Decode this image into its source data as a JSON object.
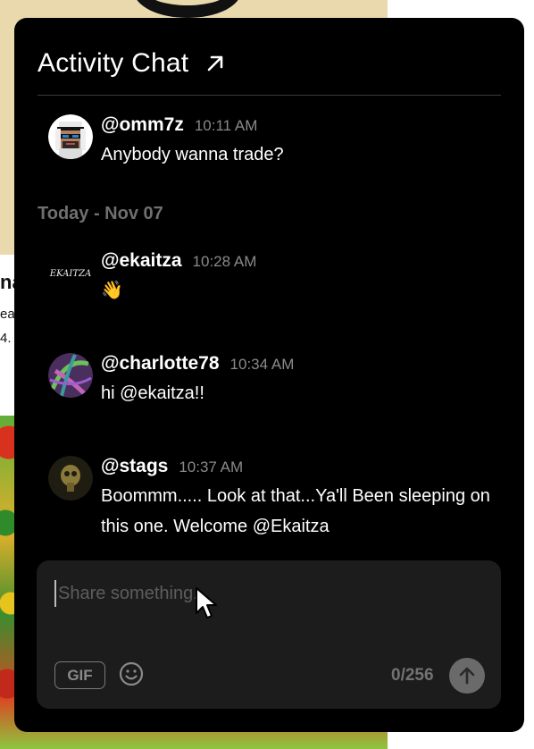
{
  "background": {
    "line1": "na",
    "line2": "ea",
    "line3": "4."
  },
  "chat": {
    "title": "Activity Chat",
    "expand_icon": "arrow-up-right-icon",
    "date_separator": "Today - Nov 07",
    "messages": [
      {
        "username": "@omm7z",
        "time": "10:11 AM",
        "text": "Anybody wanna trade?",
        "avatar": "pixel-art-avatar"
      },
      {
        "username": "@ekaitza",
        "time": "10:28 AM",
        "text": "👋",
        "avatar": "ekaitza-logo-avatar",
        "avatar_text": "EKAITZA"
      },
      {
        "username": "@charlotte78",
        "time": "10:34 AM",
        "text": "hi @ekaitza!!",
        "avatar": "abstract-art-avatar"
      },
      {
        "username": "@stags",
        "time": "10:37 AM",
        "text": "Boommm..... Look at that...Ya'll Been sleeping on this one. Welcome @Ekaitza",
        "avatar": "mask-avatar"
      }
    ]
  },
  "composer": {
    "placeholder": "Share something...",
    "gif_label": "GIF",
    "emoji_icon": "smiley-icon",
    "char_count": "0/256",
    "send_icon": "arrow-up-icon"
  },
  "colors": {
    "panel_bg": "#000000",
    "composer_bg": "#1c1c1c",
    "muted_text": "#8a8a8a",
    "send_button": "#6a6a6a"
  }
}
